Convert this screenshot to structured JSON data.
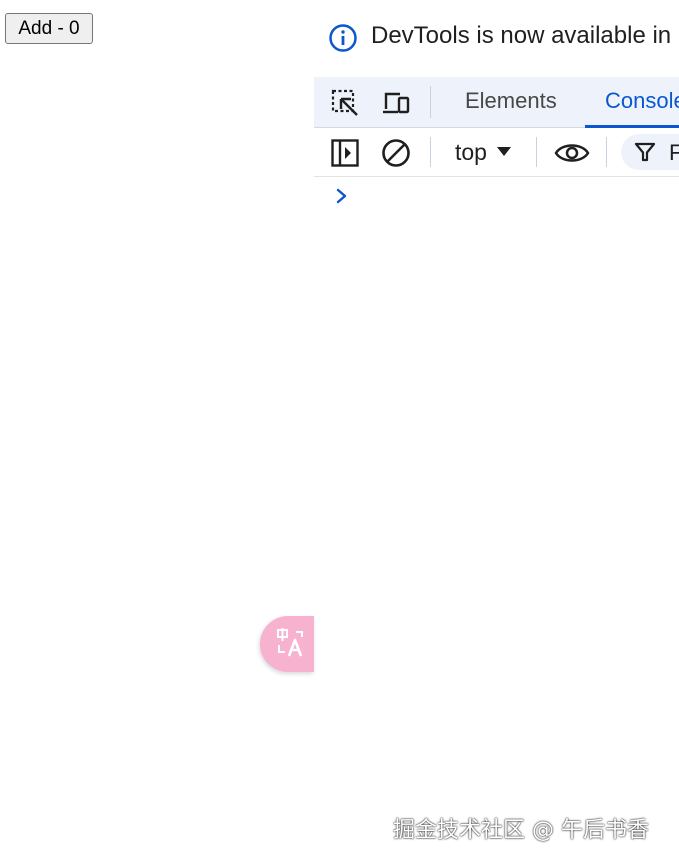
{
  "page": {
    "add_button_label": "Add - 0"
  },
  "devtools": {
    "info_text": "DevTools is now available in C",
    "tabs": [
      {
        "label": "Elements",
        "active": false
      },
      {
        "label": "Console",
        "active": true
      }
    ],
    "console": {
      "context_value": "top",
      "filter_text": "F",
      "prompt_glyph": "›"
    },
    "icons": {
      "info": "info-icon",
      "inspect": "inspect-element-icon",
      "device": "device-toolbar-icon",
      "sidebar": "sidebar-toggle-icon",
      "clear": "clear-console-icon",
      "eye": "live-expression-eye-icon",
      "filter": "filter-icon",
      "translate": "translate-icon"
    },
    "colors": {
      "accent": "#0b57d0",
      "tabbar_bg": "#eef3fb"
    }
  },
  "translate_fab": {
    "color": "#f7b2cf"
  },
  "watermark": {
    "text": "掘金技术社区 @ 午后书香"
  }
}
